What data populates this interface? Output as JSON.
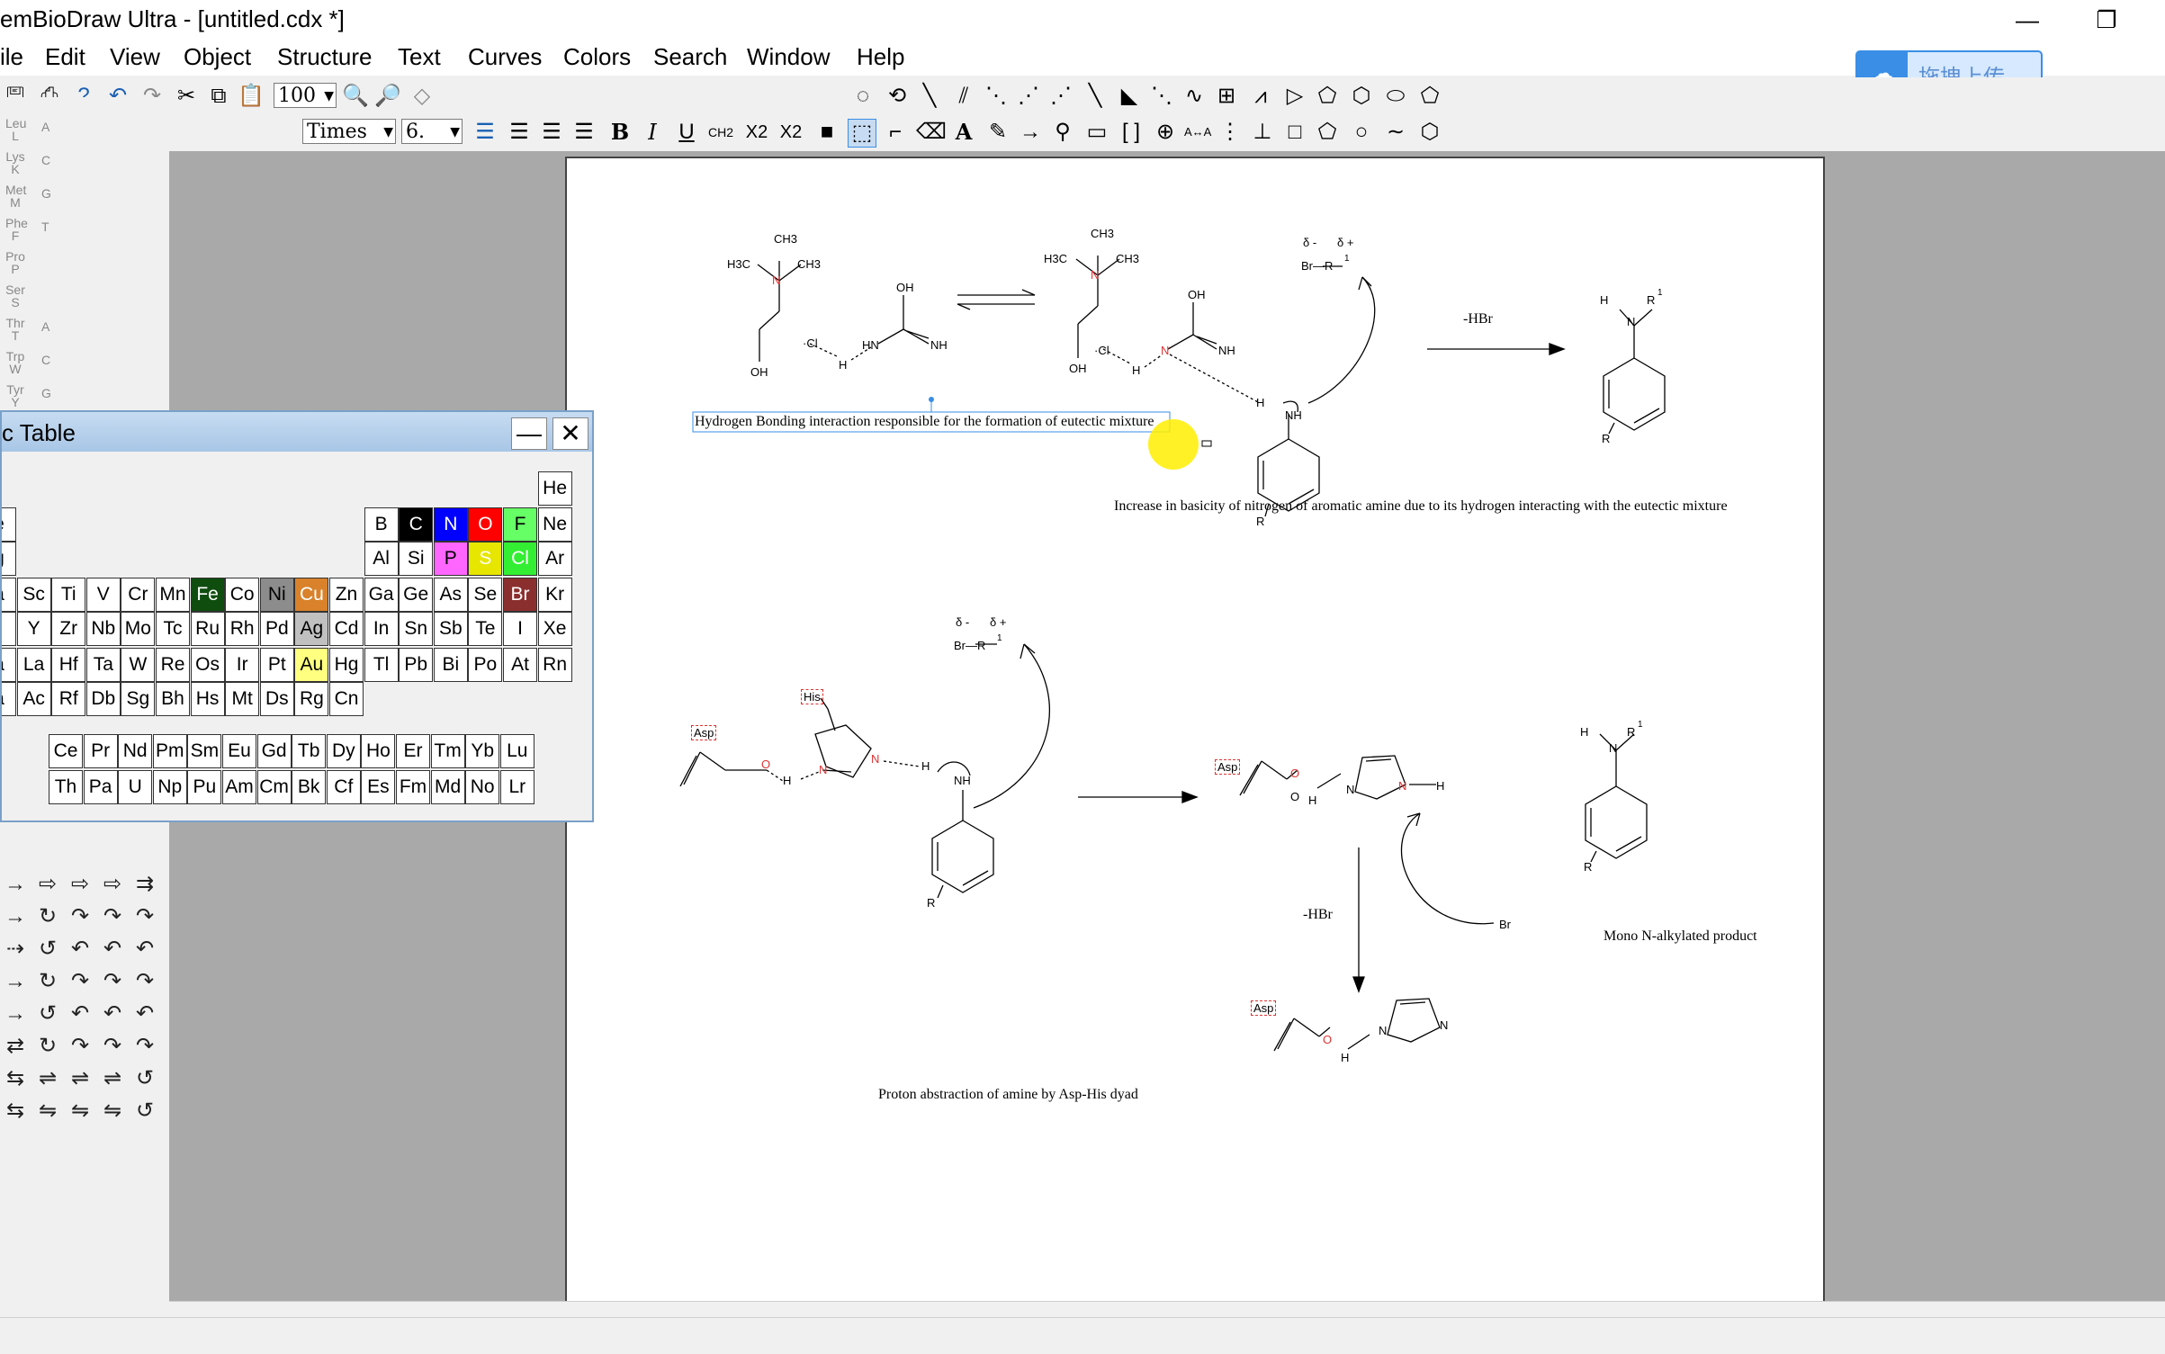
{
  "window": {
    "title": "emBioDraw Ultra - [untitled.cdx *]",
    "minimize": "—",
    "restore": "❐"
  },
  "menu": [
    "ile",
    "Edit",
    "View",
    "Object",
    "Structure",
    "Text",
    "Curves",
    "Colors",
    "Search",
    "Window",
    "Help"
  ],
  "toolbar": {
    "zoom_value": "100",
    "font_name": "Times",
    "font_size": "6.",
    "upload_label": "拖拽上传",
    "bold": "B",
    "italic": "I",
    "underline": "U",
    "formula": "CH2",
    "subscript": "X2",
    "superscript": "X2"
  },
  "amino_palette": [
    {
      "l1": "Leu",
      "l2": "L",
      "l3": "A"
    },
    {
      "l1": "Lys",
      "l2": "K",
      "l3": "C"
    },
    {
      "l1": "Met",
      "l2": "M",
      "l3": "G"
    },
    {
      "l1": "Phe",
      "l2": "F",
      "l3": "T"
    },
    {
      "l1": "Pro",
      "l2": "P",
      "l3": ""
    },
    {
      "l1": "Ser",
      "l2": "S",
      "l3": ""
    },
    {
      "l1": "Thr",
      "l2": "T",
      "l3": "A"
    },
    {
      "l1": "Trp",
      "l2": "W",
      "l3": "C"
    },
    {
      "l1": "Tyr",
      "l2": "Y",
      "l3": "G"
    }
  ],
  "periodic_table": {
    "title": "c Table",
    "minimize": "—",
    "close": "✕",
    "rows": [
      [
        {
          "s": "He",
          "c": 16
        }
      ],
      [
        {
          "s": "e",
          "c": 0
        },
        {
          "s": "B",
          "c": 11
        },
        {
          "s": "C",
          "c": 12,
          "bg": "#000000",
          "fg": "#ffffff"
        },
        {
          "s": "N",
          "c": 13,
          "bg": "#0000ff",
          "fg": "#ffffff"
        },
        {
          "s": "O",
          "c": 14,
          "bg": "#ff0000",
          "fg": "#ffffff"
        },
        {
          "s": "F",
          "c": 15,
          "bg": "#66ff66"
        },
        {
          "s": "Ne",
          "c": 16
        }
      ],
      [
        {
          "s": "g",
          "c": 0
        },
        {
          "s": "Al",
          "c": 11
        },
        {
          "s": "Si",
          "c": 12
        },
        {
          "s": "P",
          "c": 13,
          "bg": "#ff66ff"
        },
        {
          "s": "S",
          "c": 14,
          "bg": "#e6e600",
          "fg": "#ffffff"
        },
        {
          "s": "Cl",
          "c": 15,
          "bg": "#33ee33",
          "fg": "#ffffff"
        },
        {
          "s": "Ar",
          "c": 16
        }
      ],
      [
        {
          "s": "a",
          "c": 0
        },
        {
          "s": "Sc",
          "c": 1
        },
        {
          "s": "Ti",
          "c": 2
        },
        {
          "s": "V",
          "c": 3
        },
        {
          "s": "Cr",
          "c": 4
        },
        {
          "s": "Mn",
          "c": 5
        },
        {
          "s": "Fe",
          "c": 6,
          "bg": "#0f4d0f",
          "fg": "#ffffff"
        },
        {
          "s": "Co",
          "c": 7
        },
        {
          "s": "Ni",
          "c": 8,
          "bg": "#8c8c8c"
        },
        {
          "s": "Cu",
          "c": 9,
          "bg": "#d9822b",
          "fg": "#ffffff"
        },
        {
          "s": "Zn",
          "c": 10
        },
        {
          "s": "Ga",
          "c": 11
        },
        {
          "s": "Ge",
          "c": 12
        },
        {
          "s": "As",
          "c": 13
        },
        {
          "s": "Se",
          "c": 14
        },
        {
          "s": "Br",
          "c": 15,
          "bg": "#8b2e2e",
          "fg": "#ffffff"
        },
        {
          "s": "Kr",
          "c": 16
        }
      ],
      [
        {
          "s": "",
          "c": 0
        },
        {
          "s": "Y",
          "c": 1
        },
        {
          "s": "Zr",
          "c": 2
        },
        {
          "s": "Nb",
          "c": 3
        },
        {
          "s": "Mo",
          "c": 4
        },
        {
          "s": "Tc",
          "c": 5
        },
        {
          "s": "Ru",
          "c": 6
        },
        {
          "s": "Rh",
          "c": 7
        },
        {
          "s": "Pd",
          "c": 8
        },
        {
          "s": "Ag",
          "c": 9,
          "bg": "#c0c0c0"
        },
        {
          "s": "Cd",
          "c": 10
        },
        {
          "s": "In",
          "c": 11
        },
        {
          "s": "Sn",
          "c": 12
        },
        {
          "s": "Sb",
          "c": 13
        },
        {
          "s": "Te",
          "c": 14
        },
        {
          "s": "I",
          "c": 15
        },
        {
          "s": "Xe",
          "c": 16
        }
      ],
      [
        {
          "s": "a",
          "c": 0
        },
        {
          "s": "La",
          "c": 1
        },
        {
          "s": "Hf",
          "c": 2
        },
        {
          "s": "Ta",
          "c": 3
        },
        {
          "s": "W",
          "c": 4
        },
        {
          "s": "Re",
          "c": 5
        },
        {
          "s": "Os",
          "c": 6
        },
        {
          "s": "Ir",
          "c": 7
        },
        {
          "s": "Pt",
          "c": 8
        },
        {
          "s": "Au",
          "c": 9,
          "bg": "#ffff80"
        },
        {
          "s": "Hg",
          "c": 10
        },
        {
          "s": "Tl",
          "c": 11
        },
        {
          "s": "Pb",
          "c": 12
        },
        {
          "s": "Bi",
          "c": 13
        },
        {
          "s": "Po",
          "c": 14
        },
        {
          "s": "At",
          "c": 15
        },
        {
          "s": "Rn",
          "c": 16
        }
      ],
      [
        {
          "s": "a",
          "c": 0
        },
        {
          "s": "Ac",
          "c": 1
        },
        {
          "s": "Rf",
          "c": 2
        },
        {
          "s": "Db",
          "c": 3
        },
        {
          "s": "Sg",
          "c": 4
        },
        {
          "s": "Bh",
          "c": 5
        },
        {
          "s": "Hs",
          "c": 6
        },
        {
          "s": "Mt",
          "c": 7
        },
        {
          "s": "Ds",
          "c": 8
        },
        {
          "s": "Rg",
          "c": 9
        },
        {
          "s": "Cn",
          "c": 10
        }
      ]
    ],
    "lanthanides": [
      "Ce",
      "Pr",
      "Nd",
      "Pm",
      "Sm",
      "Eu",
      "Gd",
      "Tb",
      "Dy",
      "Ho",
      "Er",
      "Tm",
      "Yb",
      "Lu"
    ],
    "actinides": [
      "Th",
      "Pa",
      "U",
      "Np",
      "Pu",
      "Am",
      "Cm",
      "Bk",
      "Cf",
      "Es",
      "Fm",
      "Md",
      "No",
      "Lr"
    ]
  },
  "document": {
    "ch3": "CH3",
    "h3c": "H3C",
    "oh": "OH",
    "nh": "NH",
    "hn": "HN",
    "h": "H",
    "n": "N",
    "cl": "Cl",
    "cl_minus": "·Cl",
    "delta_minus": "δ -",
    "delta_plus": "δ +",
    "br_r1": "Br—R",
    "r": "R",
    "r1": "1",
    "minus_hbr": "-HBr",
    "asp": "Asp",
    "his": "His",
    "o": "O",
    "br_minus": "Br",
    "caption1": "Hydrogen Bonding interaction responsible for the formation of eutectic mixture",
    "caption2": "Increase in basicity of nitrogen of aromatic amine due to its hydrogen interacting with the eutectic mixture",
    "caption3": "Proton abstraction of amine by Asp-His dyad",
    "caption4": "Mono N-alkylated product"
  }
}
